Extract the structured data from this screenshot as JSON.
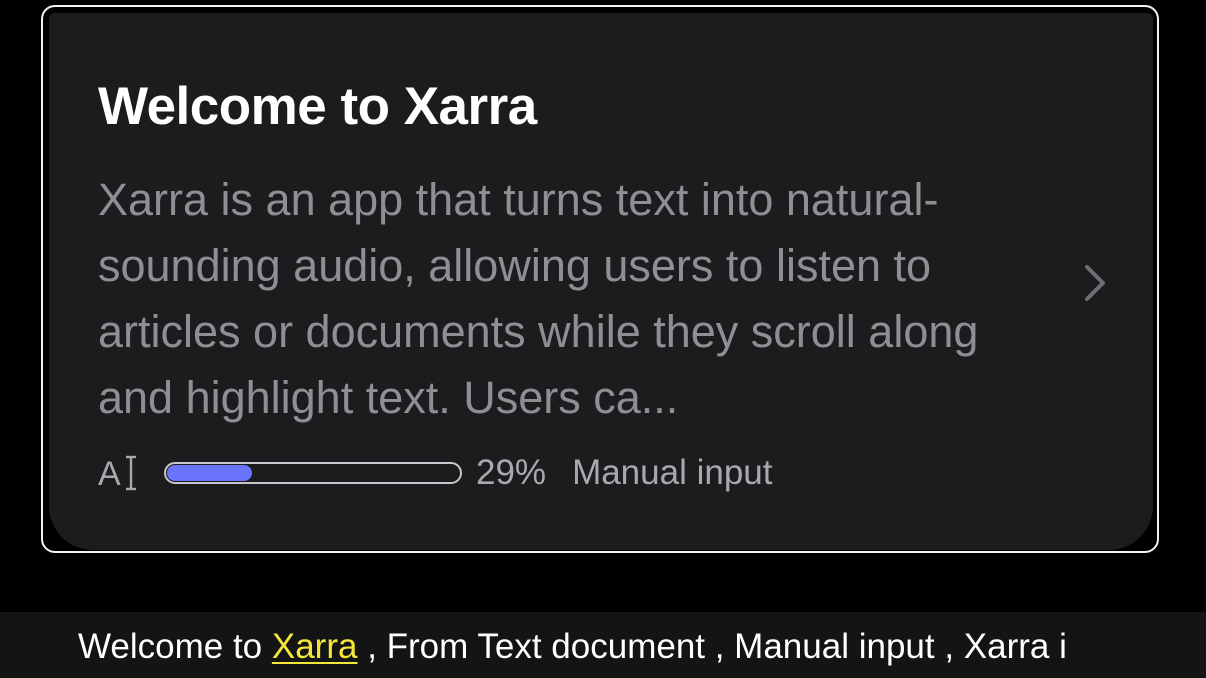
{
  "card": {
    "title": "Welcome to Xarra",
    "description": "Xarra is an app that turns text into natural-sounding audio, allowing users to listen to articles or documents while they scroll along and highlight text. Users ca...",
    "source_icon": "text-cursor-icon",
    "progress_percent": 29,
    "progress_label": "29%",
    "source_label": "Manual input",
    "chevron_icon": "chevron-right-icon"
  },
  "caption": {
    "before": "Welcome to ",
    "highlight": "Xarra",
    "after": " , From Text document , Manual input , Xarra i"
  },
  "colors": {
    "background": "#000000",
    "card": "#1c1c1e",
    "progress_fill": "#6b74ff",
    "caption_highlight": "#f5e63a"
  }
}
